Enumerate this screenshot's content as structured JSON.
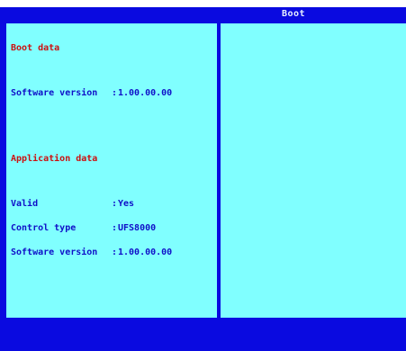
{
  "window": {
    "title": "Boot"
  },
  "boot_data": {
    "heading": "Boot data",
    "rows": [
      {
        "label": "Software version",
        "value": "1.00.00.00"
      }
    ]
  },
  "application_data": {
    "heading": "Application data",
    "rows": [
      {
        "label": "Valid",
        "value": "Yes"
      },
      {
        "label": "Control type",
        "value": "UFS8000"
      },
      {
        "label": "Software version",
        "value": "1.00.00.00"
      }
    ]
  },
  "separator": ":",
  "colors": {
    "background_blue": "#0a0ae0",
    "panel_cyan": "#80ffff",
    "heading_red": "#cc1010",
    "text_blue": "#1010c8"
  }
}
